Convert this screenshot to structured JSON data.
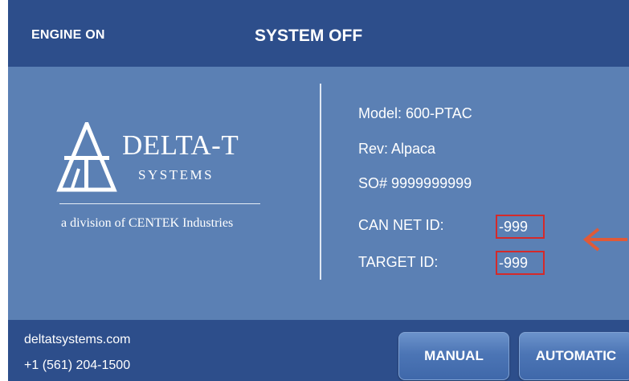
{
  "header": {
    "engine_status": "ENGINE ON",
    "system_status": "SYSTEM OFF"
  },
  "logo": {
    "name": "DELTA-T",
    "sub": "SYSTEMS",
    "division": "a division of CENTEK Industries"
  },
  "info": {
    "model": "Model: 600-PTAC",
    "rev": "Rev: Alpaca",
    "so": "SO#  9999999999",
    "can_net_label": "CAN NET ID:",
    "can_net_value": "-999",
    "target_label": "TARGET ID:",
    "target_value": "-999"
  },
  "footer": {
    "website": "deltatsystems.com",
    "phone": "+1 (561) 204-1500"
  },
  "buttons": {
    "manual": "MANUAL",
    "automatic": "AUTOMATIC"
  },
  "colors": {
    "header_bg": "#2d4e8b",
    "main_bg": "#5b80b4",
    "highlight": "#d42a2a",
    "arrow": "#e05a38"
  },
  "icons": [
    "delta-t-logo-icon",
    "left-arrow-icon"
  ]
}
